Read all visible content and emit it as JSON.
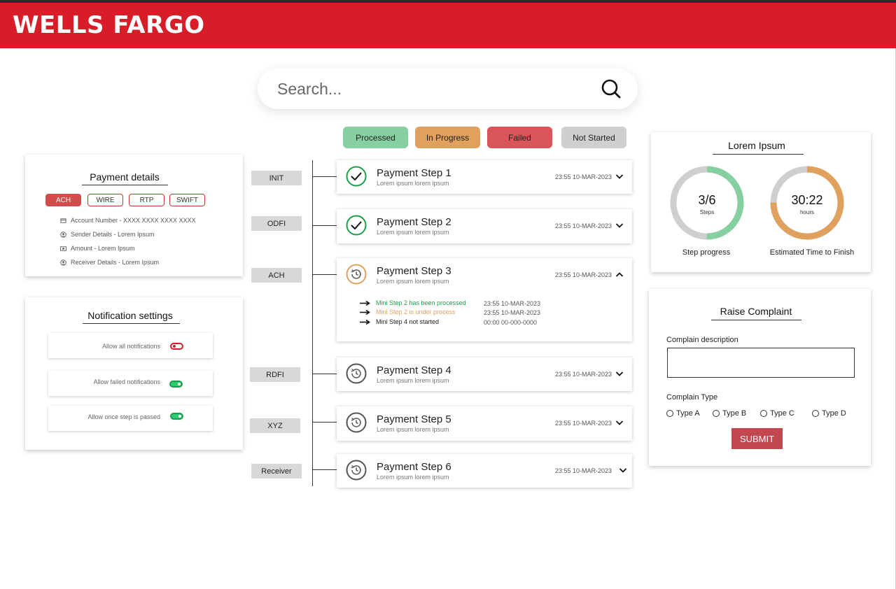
{
  "header": {
    "logo_text": "WELLS FARGO",
    "brand_color": "#d71e28"
  },
  "search": {
    "placeholder": "Search...",
    "icon": "search-icon"
  },
  "legend": [
    {
      "label": "Processed",
      "color": "#86cfa0"
    },
    {
      "label": "In Progress",
      "color": "#e0a05e"
    },
    {
      "label": "Failed",
      "color": "#d9555a"
    },
    {
      "label": "Not Started",
      "color": "#cfcfcf"
    }
  ],
  "payment_details": {
    "title": "Payment details",
    "tabs": [
      "ACH",
      "WIRE",
      "RTP",
      "SWIFT"
    ],
    "active_tab": "ACH",
    "rows": [
      {
        "icon": "card-icon",
        "text": "Account Number - XXXX XXXX XXXX XXXX"
      },
      {
        "icon": "user-icon",
        "text": "Sender Details - Lorem Ipsum"
      },
      {
        "icon": "money-icon",
        "text": "Amount - Lorem Ipsum"
      },
      {
        "icon": "user-icon",
        "text": "Receiver Details - Lorem Ipsum"
      }
    ]
  },
  "notification_settings": {
    "title": "Notification settings",
    "items": [
      {
        "label": "Allow all notifications",
        "enabled": false
      },
      {
        "label": "Allow failed notifications",
        "enabled": true
      },
      {
        "label": "Allow once step is passed",
        "enabled": true
      }
    ]
  },
  "stages": [
    "INIT",
    "ODFI",
    "ACH",
    "RDFI",
    "XYZ",
    "Receiver"
  ],
  "steps": [
    {
      "title": "Payment Step 1",
      "subtitle": "Lorem ipsum lorem ipsum",
      "date": "23:55 10-MAR-2023",
      "status": "processed",
      "expanded": false
    },
    {
      "title": "Payment Step 2",
      "subtitle": "Lorem ipsum lorem ipsum",
      "date": "23:55 10-MAR-2023",
      "status": "processed",
      "expanded": false
    },
    {
      "title": "Payment Step 3",
      "subtitle": "Lorem ipsum lorem ipsum",
      "date": "23:55 10-MAR-2023",
      "status": "in-progress",
      "expanded": true,
      "mini_steps": [
        {
          "text": "Mini Step 2 has been processed",
          "date": "23:55 10-MAR-2023",
          "color": "#1e9e4a"
        },
        {
          "text": "Mini Step 2 is under process",
          "date": "23:55 10-MAR-2023",
          "color": "#e0a05e"
        },
        {
          "text": "Mini Step 4 not started",
          "date": "00:00 00-000-0000",
          "color": "#222222"
        }
      ]
    },
    {
      "title": "Payment Step 4",
      "subtitle": "Lorem ipsum lorem ipsum",
      "date": "23:55 10-MAR-2023",
      "status": "not-started",
      "expanded": false
    },
    {
      "title": "Payment Step 5",
      "subtitle": "Lorem ipsum lorem ipsum",
      "date": "23:55 10-MAR-2023",
      "status": "not-started",
      "expanded": false
    },
    {
      "title": "Payment Step 6",
      "subtitle": "Lorem ipsum lorem ipsum",
      "date": "23:55 10-MAR-2023",
      "status": "not-started",
      "expanded": false
    }
  ],
  "progress_card": {
    "title": "Lorem Ipsum",
    "rings": [
      {
        "value": "3/6",
        "unit": "Steps",
        "caption": "Step progress",
        "fraction": 0.5,
        "color": "#86cfa0"
      },
      {
        "value": "30:22",
        "unit": "hours",
        "caption": "Estimated Time to Finish",
        "fraction": 0.75,
        "color": "#e0a05e"
      }
    ]
  },
  "complaint": {
    "title": "Raise Complaint",
    "description_label": "Complain description",
    "type_label": "Complain Type",
    "types": [
      "Type A",
      "Type B",
      "Type C",
      "Type D"
    ],
    "submit_label": "SUBMIT"
  }
}
